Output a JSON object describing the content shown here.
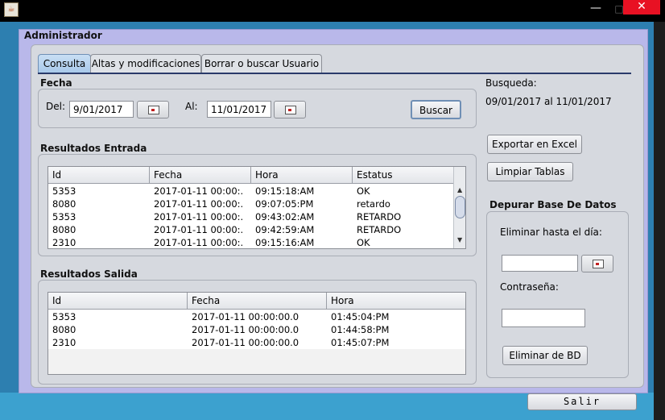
{
  "window": {
    "minimize": "—",
    "maximize": "□",
    "close": "✕",
    "app_icon": "java-icon"
  },
  "panel_title": "Administrador",
  "tabs": [
    {
      "label": "Consulta",
      "selected": true
    },
    {
      "label": "Altas y modificaciones",
      "selected": false
    },
    {
      "label": "Borrar o buscar Usuario",
      "selected": false
    }
  ],
  "fecha": {
    "title": "Fecha",
    "del_label": "Del:",
    "del_value": "9/01/2017",
    "al_label": "Al:",
    "al_value": "11/01/2017",
    "buscar": "Buscar"
  },
  "busqueda": {
    "label": "Busqueda:",
    "value": "09/01/2017 al 11/01/2017"
  },
  "actions": {
    "export": "Exportar en Excel",
    "clear": "Limpiar Tablas"
  },
  "entrada": {
    "title": "Resultados Entrada",
    "columns": [
      "Id",
      "Fecha",
      "Hora",
      "Estatus"
    ],
    "rows": [
      [
        "5353",
        "2017-01-11 00:00:...",
        "09:15:18:AM",
        "OK"
      ],
      [
        "8080",
        "2017-01-11 00:00:...",
        "09:07:05:PM",
        "retardo"
      ],
      [
        "5353",
        "2017-01-11 00:00:...",
        "09:43:02:AM",
        "RETARDO"
      ],
      [
        "8080",
        "2017-01-11 00:00:...",
        "09:42:59:AM",
        "RETARDO"
      ],
      [
        "2310",
        "2017-01-11 00:00:...",
        "09:15:16:AM",
        "OK"
      ]
    ]
  },
  "salida": {
    "title": "Resultados Salida",
    "columns": [
      "Id",
      "Fecha",
      "Hora"
    ],
    "rows": [
      [
        "5353",
        "2017-01-11 00:00:00.0",
        "01:45:04:PM"
      ],
      [
        "8080",
        "2017-01-11 00:00:00.0",
        "01:44:58:PM"
      ],
      [
        "2310",
        "2017-01-11 00:00:00.0",
        "01:45:07:PM"
      ]
    ]
  },
  "depurar": {
    "title": "Depurar Base De Datos",
    "eliminar_label": "Eliminar hasta el día:",
    "eliminar_value": "",
    "password_label": "Contraseña:",
    "password_value": "",
    "delete_button": "Eliminar de BD"
  },
  "salir": "Salir",
  "colors": {
    "accent_tab": "#a8c9ea",
    "panel": "#b9b8ea",
    "close": "#e81123"
  }
}
